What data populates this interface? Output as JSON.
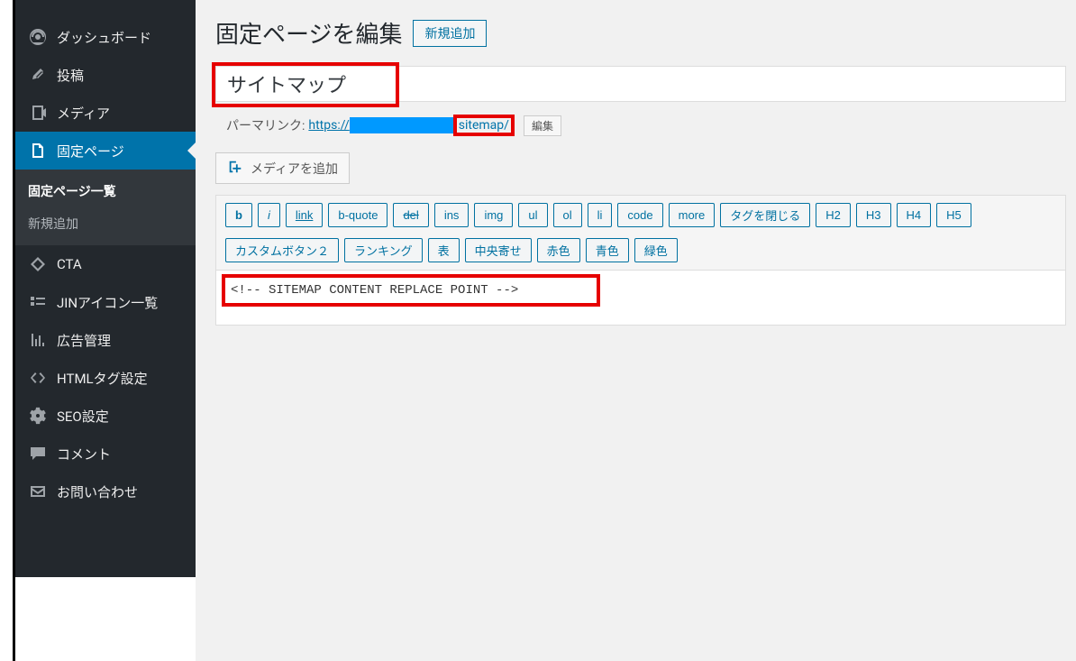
{
  "sidebar": {
    "items": [
      {
        "label": "ダッシュボード",
        "icon": "dashboard"
      },
      {
        "label": "投稿",
        "icon": "pin"
      },
      {
        "label": "メディア",
        "icon": "media"
      },
      {
        "label": "固定ページ",
        "icon": "page",
        "active": true
      },
      {
        "label": "CTA",
        "icon": "diamond"
      },
      {
        "label": "JINアイコン一覧",
        "icon": "list"
      },
      {
        "label": "広告管理",
        "icon": "chart"
      },
      {
        "label": "HTMLタグ設定",
        "icon": "code"
      },
      {
        "label": "SEO設定",
        "icon": "gear"
      },
      {
        "label": "コメント",
        "icon": "comment"
      },
      {
        "label": "お問い合わせ",
        "icon": "mail"
      }
    ],
    "submenu": [
      {
        "label": "固定ページ一覧",
        "current": true
      },
      {
        "label": "新規追加",
        "current": false
      }
    ]
  },
  "header": {
    "title": "固定ページを編集",
    "add_new": "新規追加"
  },
  "post": {
    "title": "サイトマップ",
    "permalink_label": "パーマリンク:",
    "permalink_prefix": "https://",
    "permalink_slug": "sitemap/",
    "permalink_edit": "編集"
  },
  "media_button": "メディアを追加",
  "quicktags_row1": [
    "b",
    "i",
    "link",
    "b-quote",
    "del",
    "ins",
    "img",
    "ul",
    "ol",
    "li",
    "code",
    "more",
    "タグを閉じる",
    "H2",
    "H3",
    "H4",
    "H5"
  ],
  "quicktags_row2": [
    "カスタムボタン２",
    "ランキング",
    "表",
    "中央寄せ",
    "赤色",
    "青色",
    "緑色"
  ],
  "editor_content": "<!-- SITEMAP CONTENT REPLACE POINT -->"
}
